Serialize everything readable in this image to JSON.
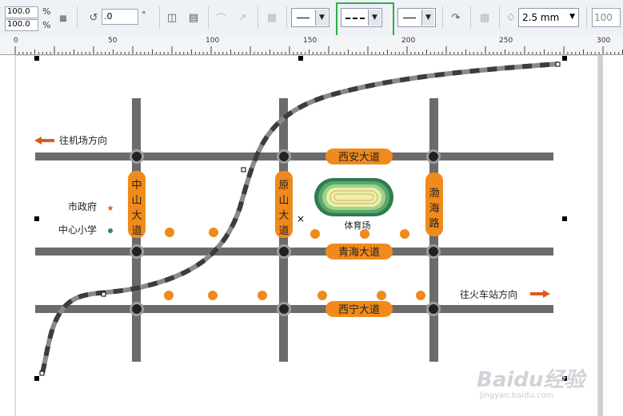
{
  "toolbar": {
    "scale_x": "100.0",
    "scale_y": "100.0",
    "percent_sign": "%",
    "rotation_value": ".0",
    "degree_sign": "°",
    "line_width_value": "2.5 mm",
    "opacity_value": "100"
  },
  "ruler": {
    "ticks": [
      "0",
      "50",
      "100",
      "150",
      "200",
      "250",
      "300"
    ]
  },
  "map": {
    "roads": {
      "xian": "西安大道",
      "qinghai": "青海大道",
      "xining": "西宁大道",
      "zhongshan": "中山大道",
      "yuanshan": "原山大道",
      "bohai": "渤海路"
    },
    "stadium": "体育场",
    "legend_gov": "市政府",
    "legend_school": "中心小学",
    "to_airport": "往机场方向",
    "to_station": "往火车站方向"
  },
  "watermark": {
    "brand": "Baidu经验",
    "url": "jingyan.baidu.com"
  },
  "colors": {
    "road": "#6b6b6b",
    "label_orange": "#f08a1c",
    "arrow": "#e05a1a",
    "stadium_green": "#2e7d4f",
    "selection_box": "#2fae49"
  }
}
